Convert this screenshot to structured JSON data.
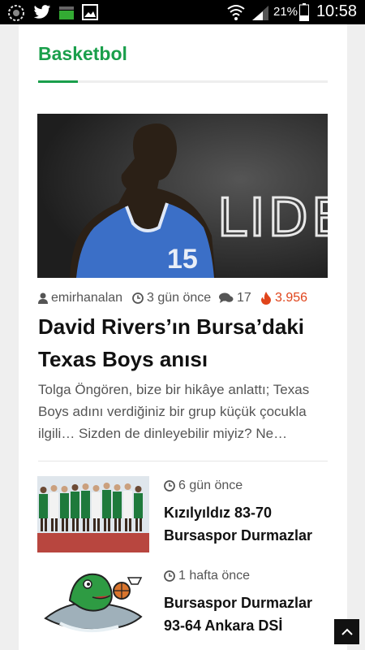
{
  "status_bar": {
    "battery_percent": "21%",
    "time": "10:58"
  },
  "section": {
    "title": "Basketbol"
  },
  "featured": {
    "image_logo_text": "LIDER",
    "jersey_number": "15",
    "author": "emirhanalan",
    "time": "3 gün önce",
    "comments": "17",
    "views": "3.956",
    "title": "David Rivers’ın Bursa’daki Texas Boys anısı",
    "excerpt": "Tolga Öngören, bize bir hikâye anlattı; Texas Boys adını verdiğiniz bir grup küçük çocukla ilgili… Sizden de dinleyebilir miyiz? Ne…"
  },
  "articles": [
    {
      "time": "6 gün önce",
      "title": "Kızılyıldız 83-70 Bursaspor Durmazlar"
    },
    {
      "time": "1 hafta önce",
      "title": "Bursaspor Durmazlar 93-64 Ankara DSİ"
    }
  ],
  "colors": {
    "accent": "#1a9f4b",
    "hot": "#e0441b"
  },
  "icons": {
    "author": "user-icon",
    "time": "clock-icon",
    "comments": "comments-icon",
    "views": "fire-icon",
    "scroll_top": "chevron-up-icon"
  }
}
